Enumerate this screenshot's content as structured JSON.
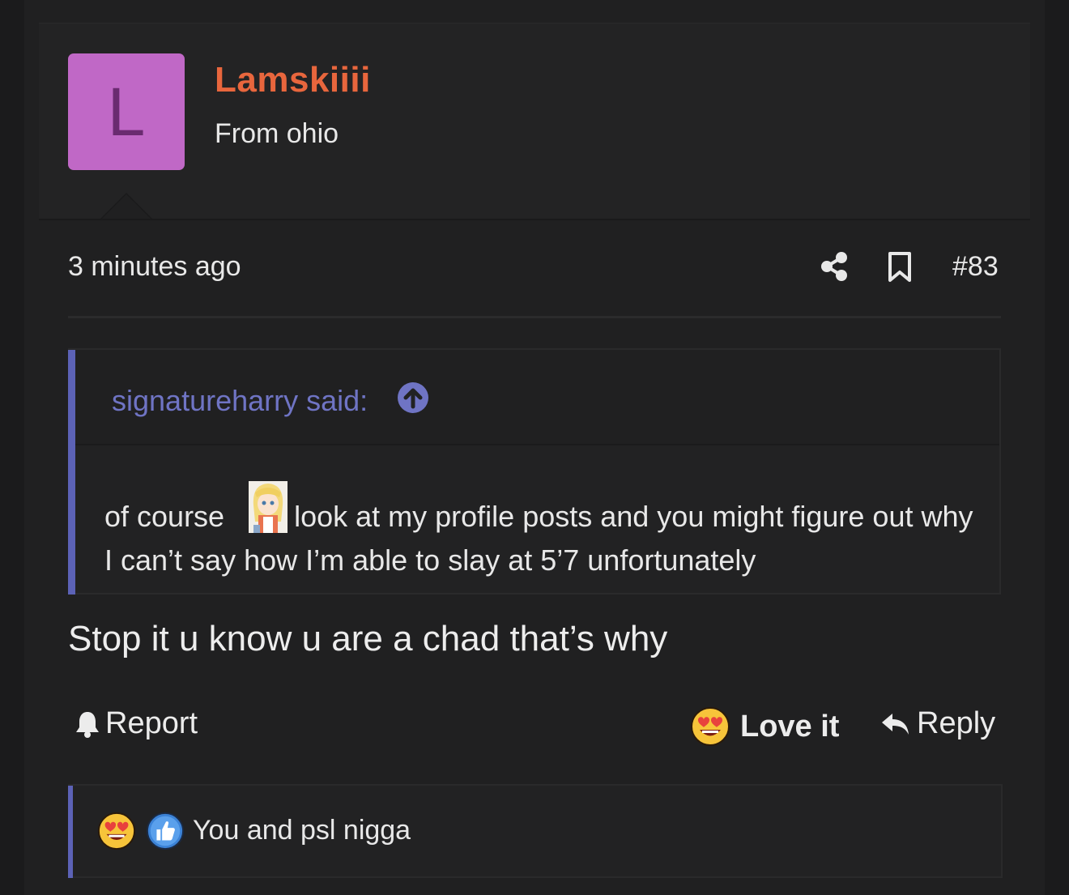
{
  "user": {
    "avatar_letter": "L",
    "username": "Lamskiiii",
    "title": "From ohio",
    "avatar_color": "#c068c6",
    "username_color": "#e8663d"
  },
  "post": {
    "time": "3 minutes ago",
    "number": "#83",
    "share_icon": "share-icon",
    "bookmark_icon": "bookmark-icon"
  },
  "quote": {
    "author": "signatureharry said:",
    "text_part1": "of course",
    "text_part2": "look at my profile posts and you might figure out why I can’t say how I’m able to slay at 5’7 unfortunately",
    "accent_color": "#5c62b6"
  },
  "message": "Stop it u know u are a chad that’s why",
  "actions": {
    "report": "Report",
    "love": "Love it",
    "reply": "Reply"
  },
  "reactions": {
    "summary": "You and psl nigga",
    "icons": [
      "heart-eyes-emoji-icon",
      "thumbs-up-icon"
    ]
  }
}
